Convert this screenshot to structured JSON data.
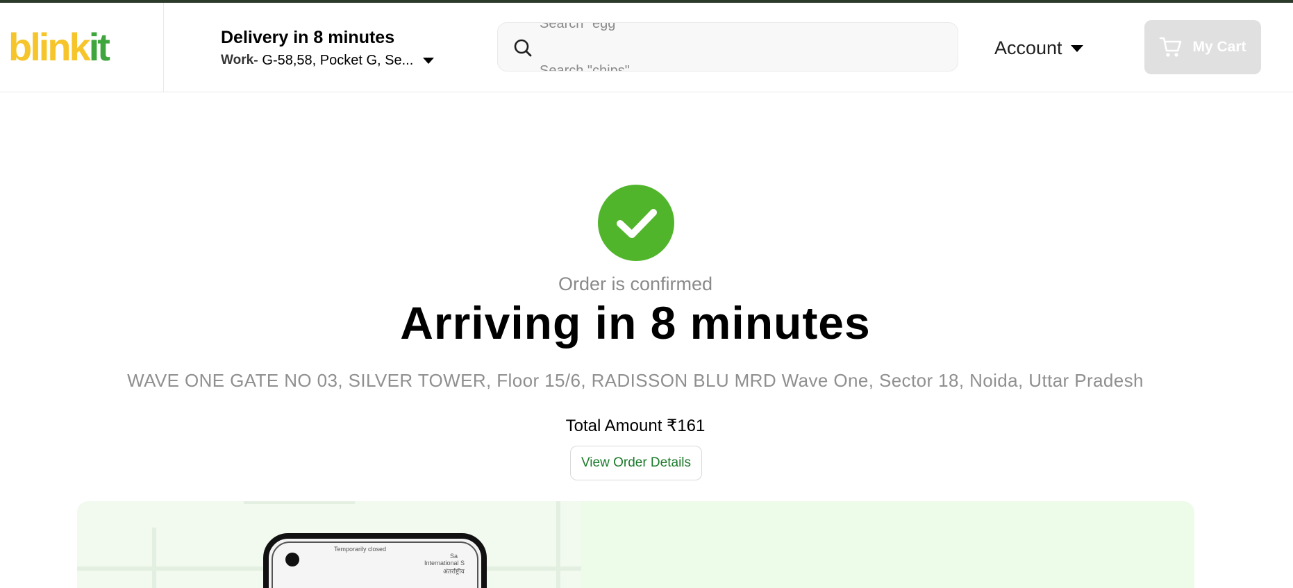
{
  "header": {
    "logo": {
      "part1": "blink",
      "part2": "it"
    },
    "delivery": {
      "title": "Delivery in 8 minutes",
      "label": "Work",
      "address": " - G-58,58, Pocket G, Se..."
    },
    "search": {
      "hint_prev": "Search \"egg\"",
      "hint_next": "Search \"chips\"",
      "icon": "search-icon"
    },
    "account_label": "Account",
    "cart_label": "My Cart"
  },
  "order": {
    "status": "Order is confirmed",
    "headline": "Arriving in 8 minutes",
    "address": "WAVE ONE GATE NO 03, SILVER TOWER, Floor 15/6, RADISSON BLU MRD Wave One, Sector 18, Noida, Uttar Pradesh",
    "total": "Total Amount ₹161",
    "view_details_label": "View Order Details"
  },
  "map": {
    "closed_label": "Temporarily closed",
    "place_label_1": "Sa",
    "place_label_2": "International S",
    "place_label_3": "अंतर्राष्ट्रीय"
  },
  "colors": {
    "brand_yellow": "#f6c52b",
    "brand_green": "#3fa63d",
    "confirm_green": "#51b52c",
    "link_green": "#1b7a2a",
    "map_bg": "#edfbe9"
  }
}
